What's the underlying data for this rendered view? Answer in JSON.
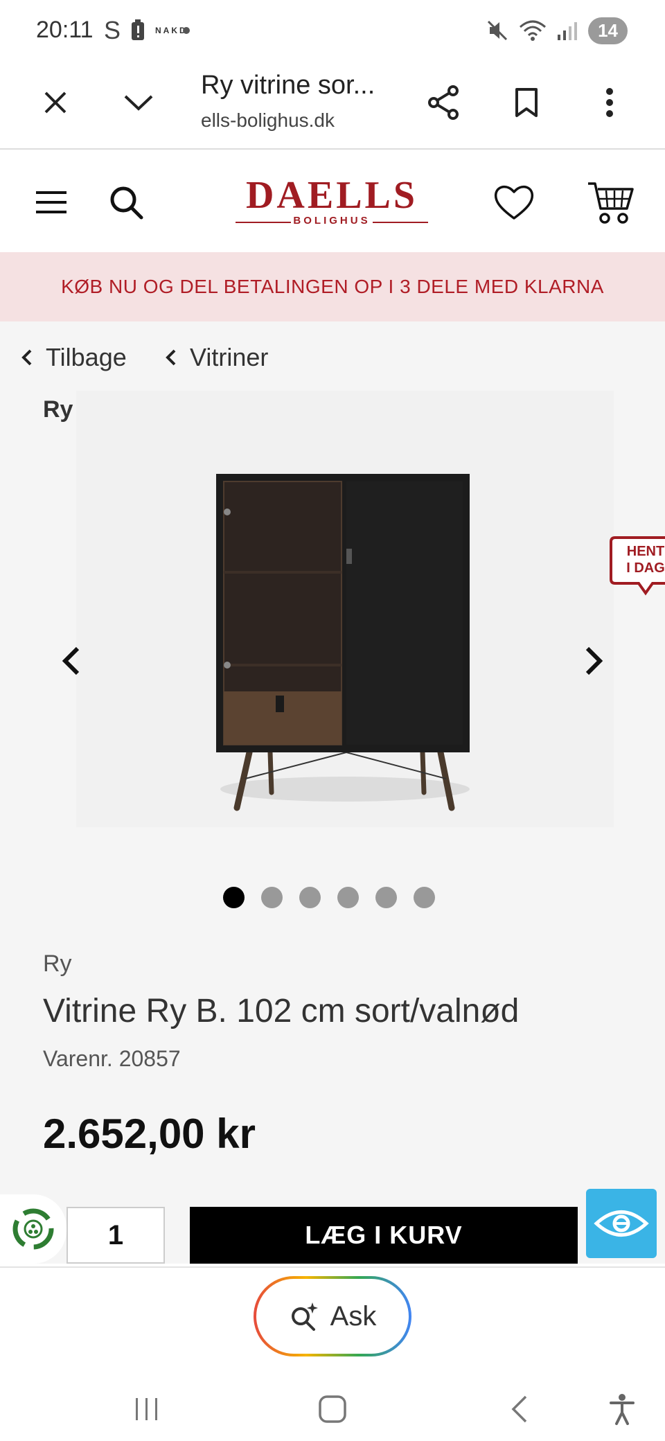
{
  "status_bar": {
    "time": "20:11",
    "carrier_letter": "S",
    "nakd": "NAKD",
    "battery": "14"
  },
  "browser": {
    "page_title": "Ry vitrine sor...",
    "url": "ells-bolighus.dk"
  },
  "header": {
    "logo_main": "DAELLS",
    "logo_sub": "BOLIGHUS"
  },
  "promo": {
    "text": "KØB NU OG DEL BETALINGEN OP I 3 DELE MED KLARNA"
  },
  "breadcrumbs": {
    "back": "Tilbage",
    "category": "Vitriner"
  },
  "gallery": {
    "brand_label": "Ry",
    "badge_line1": "HENT",
    "badge_line2": "I DAG",
    "image_count": 6,
    "active_index": 0
  },
  "product": {
    "brand": "Ry",
    "title": "Vitrine Ry B. 102 cm sort/valnød",
    "sku": "Varenr. 20857",
    "price": "2.652,00 kr"
  },
  "purchase": {
    "quantity": "1",
    "add_to_cart": "LÆG I KURV"
  },
  "assistant": {
    "ask_label": "Ask"
  },
  "colors": {
    "brand_red": "#a01c22",
    "promo_bg": "#f5e1e2",
    "promo_text": "#b01d26",
    "accessibility_blue": "#3ab4e6"
  }
}
